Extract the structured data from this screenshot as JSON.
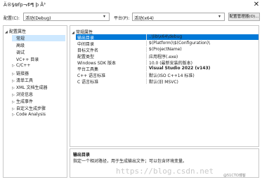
{
  "window": {
    "title": "Ä®§⁄øfp¬⁄Þ¶ þ Å³",
    "close_glyph": "✕"
  },
  "config_bar": {
    "config_label": "配置(C):",
    "config_value": "活动(Debug)",
    "platform_label": "平台(P):",
    "platform_value": "活动(x64)",
    "manager_button": "配置管理器(O)..."
  },
  "tree": [
    {
      "label": "配置属性",
      "expander": "◢",
      "level": 0,
      "selected": false
    },
    {
      "label": "常规",
      "expander": "",
      "level": 1,
      "selected": true
    },
    {
      "label": "高级",
      "expander": "",
      "level": 1,
      "selected": false
    },
    {
      "label": "调试",
      "expander": "",
      "level": 1,
      "selected": false
    },
    {
      "label": "VC++ 目录",
      "expander": "",
      "level": 1,
      "selected": false
    },
    {
      "label": "C/C++",
      "expander": "▷",
      "level": 1,
      "selected": false
    },
    {
      "label": "链接器",
      "expander": "▷",
      "level": 1,
      "selected": false
    },
    {
      "label": "清单工具",
      "expander": "▷",
      "level": 1,
      "selected": false
    },
    {
      "label": "XML 文档生成器",
      "expander": "▷",
      "level": 1,
      "selected": false
    },
    {
      "label": "浏览信息",
      "expander": "▷",
      "level": 1,
      "selected": false
    },
    {
      "label": "生成事件",
      "expander": "▷",
      "level": 1,
      "selected": false
    },
    {
      "label": "自定义生成步骤",
      "expander": "▷",
      "level": 1,
      "selected": false
    },
    {
      "label": "Code Analysis",
      "expander": "▷",
      "level": 1,
      "selected": false
    }
  ],
  "grid": {
    "category": "常规属性",
    "category_expander": "◢",
    "rows": [
      {
        "name": "输出目录",
        "value": "..\\lib\\x64\\debug",
        "bold": false,
        "selected": true
      },
      {
        "name": "中间目录",
        "value": "$(Platform)\\$(Configuration)\\",
        "bold": false,
        "selected": false
      },
      {
        "name": "目标文件名",
        "value": "$(ProjectName)",
        "bold": false,
        "selected": false
      },
      {
        "name": "配置类型",
        "value": "应用程序(.exe)",
        "bold": false,
        "selected": false
      },
      {
        "name": "Windows SDK 版本",
        "value": "10.0 (最新安装的版本)",
        "bold": false,
        "selected": false
      },
      {
        "name": "平台工具集",
        "value": "Visual Studio 2022 (v143)",
        "bold": true,
        "selected": false
      },
      {
        "name": "C++ 语言标准",
        "value": "默认(ISO C++14 标准)",
        "bold": false,
        "selected": false
      },
      {
        "name": "C 语言标准",
        "value": "默认(旧 MSVC)",
        "bold": false,
        "selected": false
      }
    ]
  },
  "description": {
    "title": "输出目录",
    "text": "指定一个相对路径，用于生成输出文件；可以包含环境变量。"
  },
  "watermark": {
    "text": "https://blog.csdn.net",
    "tag": "@51CTO博客"
  }
}
